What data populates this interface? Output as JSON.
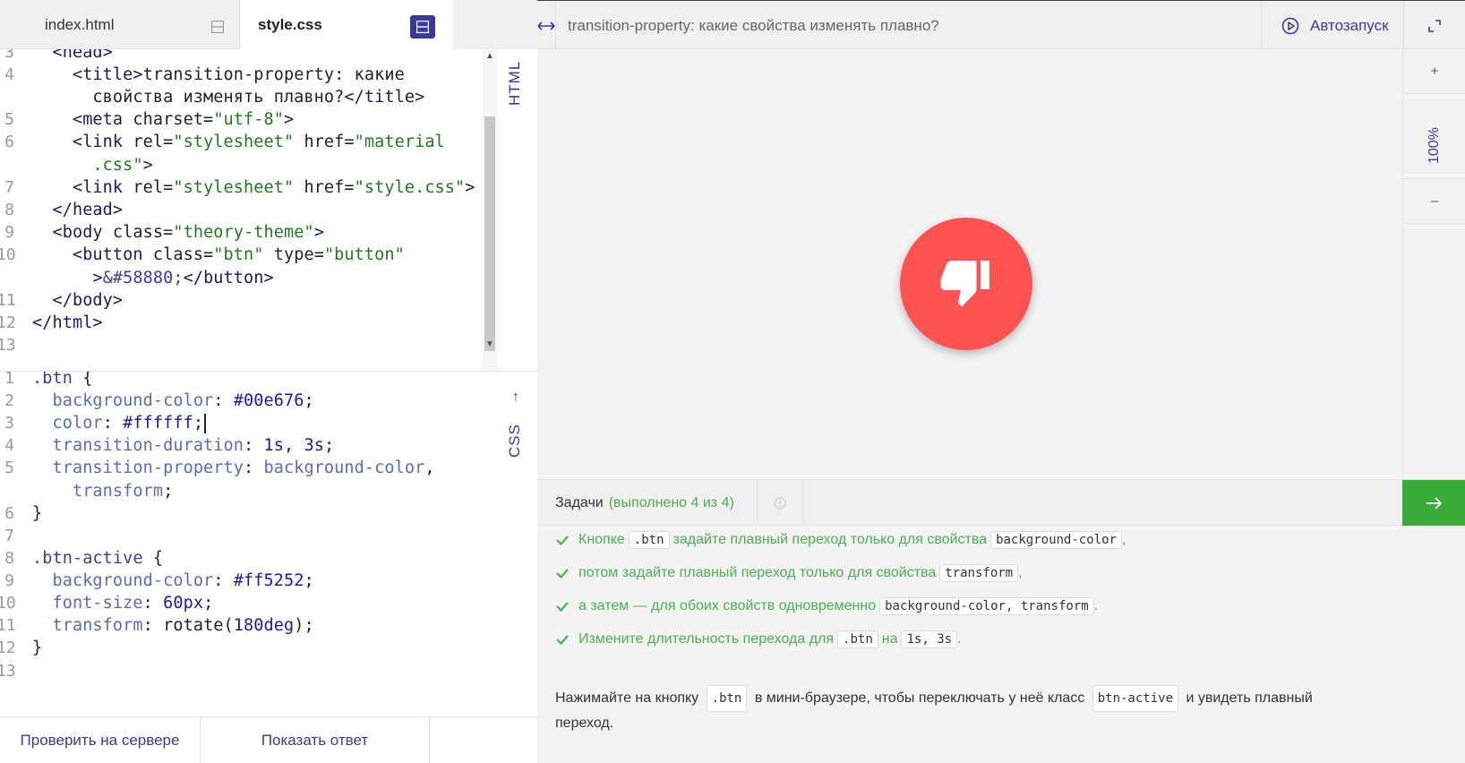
{
  "editor": {
    "tabs": [
      {
        "label": "index.html"
      },
      {
        "label": "style.css"
      }
    ],
    "html_pane_label": "HTML",
    "css_pane_label": "CSS",
    "html_line_numbers": [
      "3",
      "4",
      "",
      "5",
      "6",
      "",
      "7",
      "8",
      "9",
      "10",
      "",
      "11",
      "12",
      "13"
    ],
    "css_line_numbers": [
      "1",
      "2",
      "3",
      "4",
      "5",
      "",
      "6",
      "7",
      "8",
      "9",
      "10",
      "11",
      "12",
      "13"
    ]
  },
  "bottom_bar": {
    "check_server": "Проверить на сервере",
    "show_answer": "Показать ответ"
  },
  "preview": {
    "title": "transition-property: какие свойства изменять плавно?",
    "autorun_label": "Автозапуск",
    "zoom_level": "100%",
    "zoom_in": "+",
    "zoom_out": "–",
    "button_color": "#ff5252"
  },
  "tasks": {
    "label": "Задачи",
    "count": "(выполнено 4 из 4)",
    "items": [
      {
        "text_1": "Кнопке",
        "code_1": ".btn",
        "text_2": "задайте плавный переход только для свойства",
        "code_2": "background-color",
        "text_3": ","
      },
      {
        "text_1": "потом задайте плавный переход только для свойства",
        "code_1": "transform",
        "text_2": ","
      },
      {
        "text_1": "а затем — для обоих свойств одновременно",
        "code_1": "background-color, transform",
        "text_2": "."
      },
      {
        "text_1": "Измените длительность перехода для",
        "code_1": ".btn",
        "text_2": "на",
        "code_2": "1s, 3s",
        "text_3": "."
      }
    ],
    "note": {
      "text_1": "Нажимайте на кнопку",
      "code_1": ".btn",
      "text_2": "в мини-браузере, чтобы переключать у неё класс",
      "code_2": "btn-active",
      "text_3": "и увидеть плавный переход."
    }
  },
  "colors": {
    "accent": "#3a3a9c",
    "success": "#4caf50",
    "next_button": "#3aaa3a",
    "danger": "#ff5252"
  }
}
